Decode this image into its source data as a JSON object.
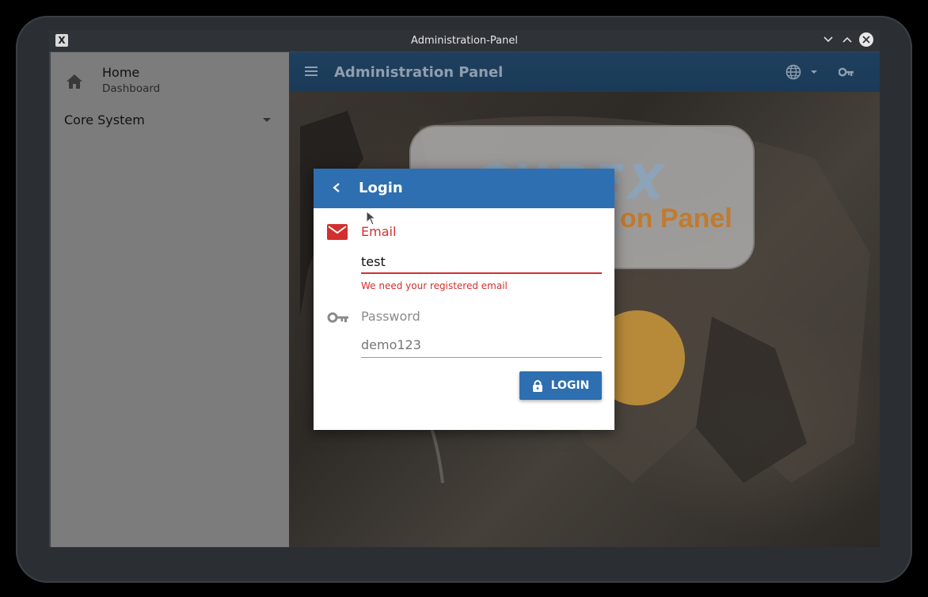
{
  "window": {
    "title": "Administration-Panel",
    "app_icon": "x-app-icon"
  },
  "sidebar": {
    "home": {
      "title": "Home",
      "subtitle": "Dashboard",
      "icon": "home-icon"
    },
    "core": {
      "label": "Core System",
      "icon": "caret-down-icon"
    }
  },
  "appbar": {
    "title": "Administration Panel",
    "icons": [
      "menu-icon",
      "globe-icon",
      "caret-down-icon",
      "key-icon"
    ]
  },
  "background": {
    "logo_text": "CUBEX",
    "logo_sub": "on Panel"
  },
  "dialog": {
    "title": "Login",
    "email": {
      "label": "Email",
      "value": "test",
      "error": "We need your registered email"
    },
    "password": {
      "label": "Password",
      "placeholder": "demo123"
    },
    "login_button": "LOGIN"
  },
  "colors": {
    "primary": "#2e6fb1",
    "error": "#d32f2f",
    "appbar": "#1f3f5e"
  }
}
